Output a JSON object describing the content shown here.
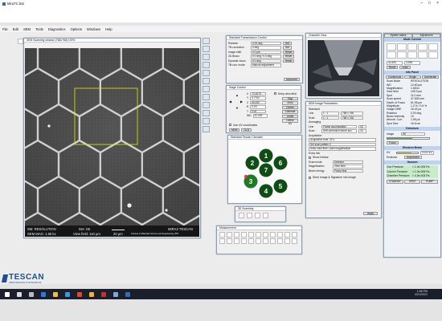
{
  "window": {
    "title": "MiraTC.bat",
    "app_icon": "app-icon"
  },
  "menu": [
    "File",
    "Edit",
    "SEM",
    "Tools",
    "Diagnostics",
    "Options",
    "Windows",
    "Help"
  ],
  "scan_window": {
    "title": "SEM Scanning window (768x768) 100%",
    "overlay": {
      "mode": "SM: RESOLUTION",
      "mag": "SEM MAG: 1.68 kx",
      "det": "Det: SE",
      "view_field": "View field: 110 µm",
      "scale": "20 µm",
      "instrument": "MIRA3 TESCAN",
      "institute": "Institute of Materials Science and Engineering, IPM"
    }
  },
  "left_toolbar_icons": [
    "pointer-icon",
    "zoom-icon",
    "pan-icon",
    "ruler-icon",
    "crosshair-icon",
    "grid-icon",
    "camera-icon",
    "info-icon"
  ],
  "right_toolbar_icons": [
    "histogram-icon",
    "contrast-icon",
    "brightness-icon",
    "focus-icon",
    "stigmator-icon",
    "save-icon",
    "print-icon",
    "settings-icon",
    "layers-icon",
    "measure-icon",
    "export-icon",
    "help-icon"
  ],
  "beam_panel": {
    "title": "Standard Transmission Control",
    "rows": [
      {
        "label": "Rotation",
        "value": "0.00 deg",
        "button": "Set"
      },
      {
        "label": "Tilt correction",
        "value": "0 deg",
        "button": "Set"
      },
      {
        "label": "Image shift",
        "value": "0.0 µm",
        "button": "Reset"
      },
      {
        "label": "2D Beam",
        "value": "0.0 deg / 0.0 deg",
        "button": "Reset"
      },
      {
        "label": "Dynamic focus",
        "value": "0.0 deg",
        "button": "Reset"
      },
      {
        "label": "Tilt corr. mode",
        "value": "Manual adjustment",
        "button": ""
      }
    ],
    "footer_button": "Advanced"
  },
  "stage_control": {
    "title": "Stage Control",
    "x": "73.1079",
    "y": "0.7702",
    "z": "40.000",
    "r": "0.00",
    "t": "0.00",
    "wd": "41.429",
    "unit": "mm",
    "checkbox": "Keep view field",
    "buttons": [
      "Stop",
      "Undo",
      "Center",
      "Calibrate",
      "Limits",
      "Define UV"
    ],
    "use_uv": "Use UV coordinates",
    "mem_tabs": [
      "MEM",
      "OLD"
    ]
  },
  "carousel": {
    "title": "Standard Tescan Carousel",
    "holders": [
      "1",
      "7",
      "6",
      "2",
      "5",
      "3",
      "4"
    ]
  },
  "chamber_view": {
    "title": "Chamber View"
  },
  "acq_panel": {
    "title": "SEM Image Parameters",
    "standard_label": "Standard",
    "line_label": "Line",
    "line_val": "1 : 1",
    "line_res": "768 x 768",
    "scan_label": "Scan",
    "scan_val": "1 : 1",
    "scan_res": "768 x 768",
    "averaging": "Averaging",
    "line_avg": "Frame accumulation",
    "scan_avg": "Drift correction frame acc.",
    "num1": "16",
    "num2": "16",
    "acquisition": "Acquisition",
    "acq_val": "Acquisition time: 32 s",
    "scan_pattern": "Set scan pattern 0",
    "keep_field": "Keep view field / pixel magnification",
    "extra_info": "Extra info",
    "show_info": "Show infobar",
    "scan_mode": "Scan mode",
    "scan_mode_val": "Detector",
    "magnification": "Magnification",
    "mag_val": "View field",
    "beam_energy": "Beam energy",
    "beam_val": "Pixely field",
    "store": "Store Image & Signature info image",
    "apply": "Apply"
  },
  "measurement": {
    "title": "Measurement"
  },
  "ezoom": {
    "title": "3D Scanning"
  },
  "right_panel": {
    "tabs": [
      "System status",
      "Adjustment"
    ],
    "section_view": "Mode Control",
    "section_info": "Info Panel",
    "info_tabs": [
      "Continuous",
      "Single",
      "Accelerate"
    ],
    "info_rows": [
      [
        "Scan Mode",
        "RESOLUTION"
      ],
      [
        "WD",
        "12.60 µm"
      ],
      [
        "Magnification",
        "1.68 kx"
      ],
      [
        "View field",
        "109.9 µm"
      ],
      [
        "Spot",
        "11.0 mm"
      ],
      [
        "Scan speed",
        "47.528 mm"
      ],
      [
        "Depth of Focus",
        "61.96 µm"
      ],
      [
        "Magnitude",
        "1.2 % / 0.6 %"
      ],
      [
        "Image DWE",
        "16.42 µs"
      ],
      [
        "Rotation",
        "0.00 deg"
      ],
      [
        "Beam intensity",
        "10"
      ],
      [
        "Absorb. Curr.",
        "1.65 pA"
      ],
      [
        "Spot Size",
        "15.6 nm"
      ]
    ],
    "pressure_section": "Vacuum",
    "pressure_rows": [
      [
        "Gun Pressure",
        "< 1.0e-005 Pa"
      ],
      [
        "Column Pressure",
        "< 1.0e-006 Pa"
      ],
      [
        "Chamber Pressure",
        "< 4.0e-003 Pa"
      ]
    ],
    "pressure_buttons": [
      "STANDBY",
      "VENT",
      "PUMP"
    ],
    "electron_section": "Electron Beam",
    "hv_label": "HV",
    "hv_val": "10.00 kV",
    "emission": "Emission",
    "emission_val": "Adjustment",
    "detector_section": "Detectors",
    "detector_val": "SE",
    "image_label": "Image",
    "image_val": "Focus"
  },
  "brand": {
    "logo": "TESCAN",
    "tagline": "PERFORMANCE IN NANOSPACE"
  },
  "taskbar": {
    "icons": [
      "start-icon",
      "search-icon",
      "task-view-icon",
      "edge-icon",
      "explorer-icon",
      "store-icon",
      "chrome-icon",
      "folder-icon",
      "acrobat-icon",
      "app-icon",
      "tescan-icon"
    ],
    "time": "1:58 PM",
    "date": "4/21/2021"
  }
}
